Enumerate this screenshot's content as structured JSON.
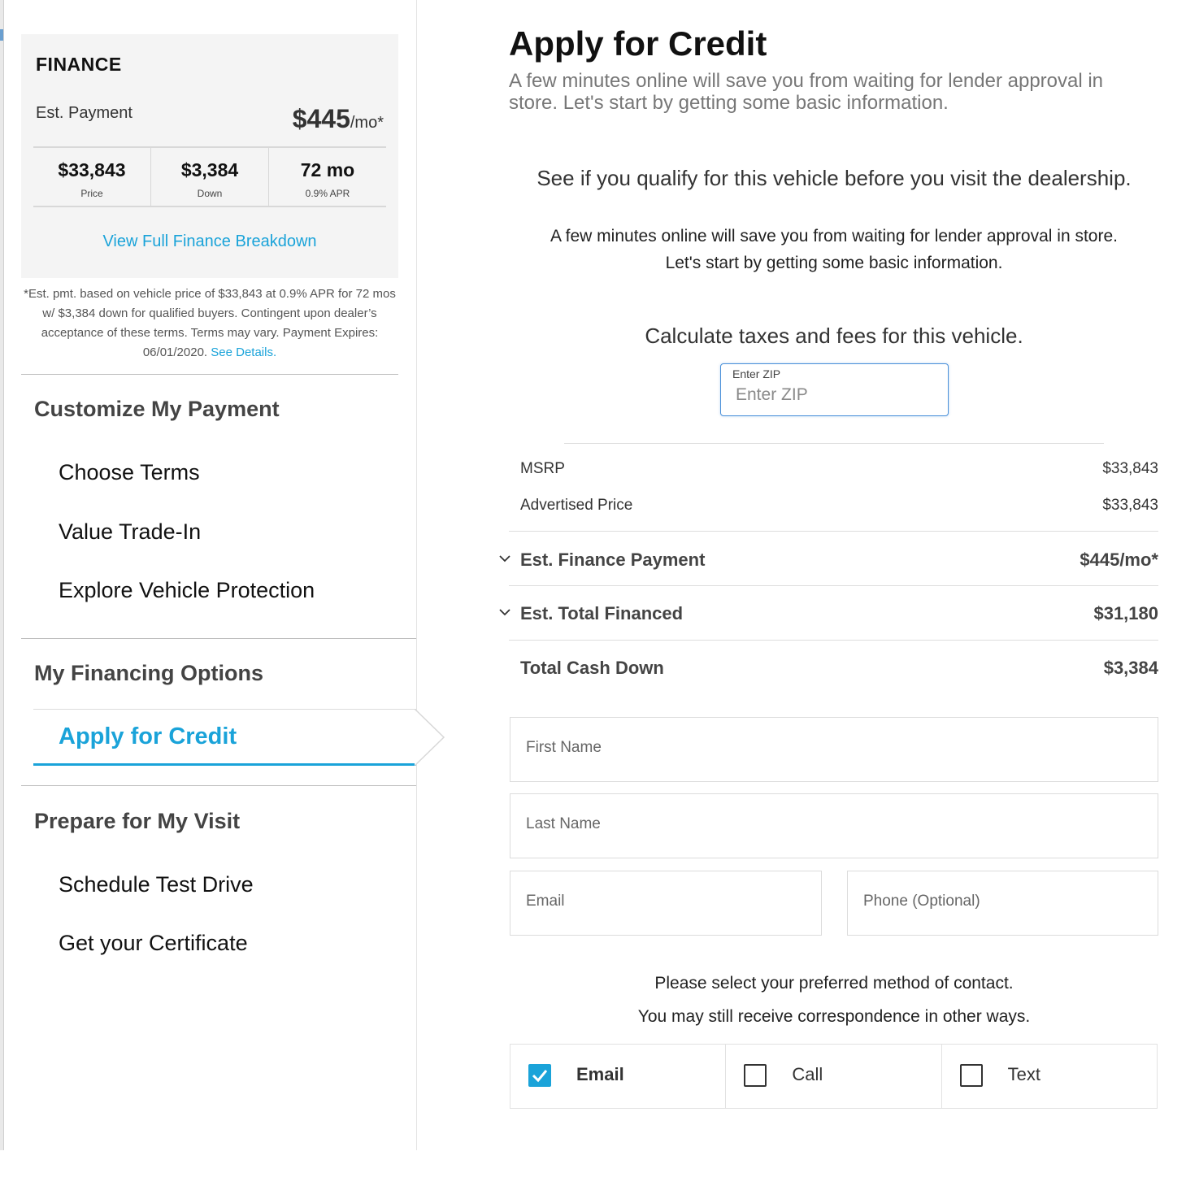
{
  "finance_card": {
    "title": "FINANCE",
    "est_payment_label": "Est. Payment",
    "est_payment_value": "$445",
    "est_payment_suffix": "/mo*",
    "cells": [
      {
        "value": "$33,843",
        "label": "Price"
      },
      {
        "value": "$3,384",
        "label": "Down"
      },
      {
        "value": "72 mo",
        "label": "0.9% APR"
      }
    ],
    "link": "View Full Finance Breakdown"
  },
  "disclaimer": {
    "text": "*Est. pmt. based on vehicle price of $33,843 at 0.9% APR for 72 mos w/ $3,384 down for qualified buyers. Contingent upon dealer’s acceptance of these terms. Terms may vary. Payment Expires: 06/01/2020.",
    "link": "See Details."
  },
  "sidebar": {
    "customize_title": "Customize My Payment",
    "customize_items": [
      "Choose Terms",
      "Value Trade-In",
      "Explore Vehicle Protection"
    ],
    "financing_title": "My Financing Options",
    "active_item": "Apply for Credit",
    "prepare_title": "Prepare for My Visit",
    "prepare_items": [
      "Schedule Test Drive",
      "Get your Certificate"
    ]
  },
  "main": {
    "title": "Apply for Credit",
    "subtitle": "A few minutes online will save you from waiting for lender approval in store. Let's start by getting some basic information.",
    "qualify": "See if you qualify for this vehicle before you visit the dealership.",
    "qualify_sub_1": "A few minutes online will save you from waiting for lender approval in store.",
    "qualify_sub_2": "Let's start by getting some basic information.",
    "calc": "Calculate taxes and fees for this vehicle.",
    "zip_label": "Enter ZIP",
    "zip_placeholder": "Enter ZIP",
    "prices": [
      {
        "label": "MSRP",
        "value": "$33,843"
      },
      {
        "label": "Advertised Price",
        "value": "$33,843"
      }
    ],
    "summary": [
      {
        "label": "Est. Finance Payment",
        "value": "$445/mo*"
      },
      {
        "label": "Est. Total Financed",
        "value": "$31,180"
      },
      {
        "label": "Total Cash Down",
        "value": "$3,384"
      }
    ],
    "form": {
      "first_name": "First Name",
      "last_name": "Last Name",
      "email": "Email",
      "phone": "Phone (Optional)"
    },
    "contact_line_1": "Please select your preferred method of contact.",
    "contact_line_2": "You may still receive correspondence in other ways.",
    "contact_options": [
      {
        "label": "Email",
        "checked": true
      },
      {
        "label": "Call",
        "checked": false
      },
      {
        "label": "Text",
        "checked": false
      }
    ]
  },
  "colors": {
    "accent": "#1aa3d9",
    "text": "#222222",
    "muted": "#777777"
  }
}
